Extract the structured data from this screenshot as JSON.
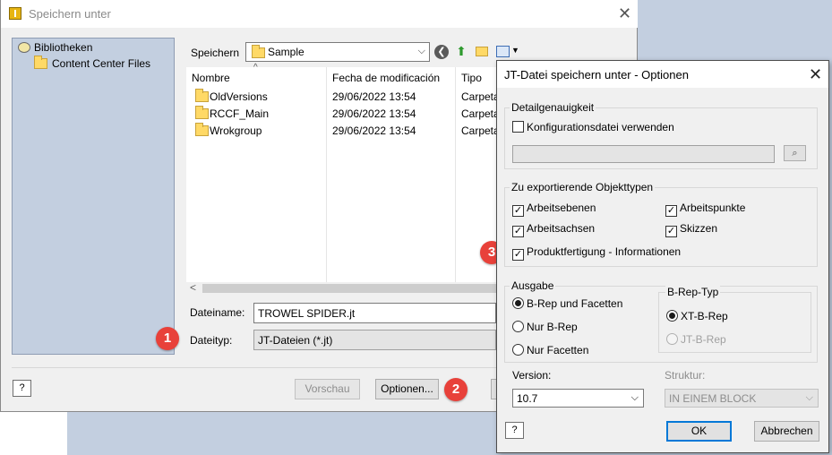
{
  "main_dialog": {
    "title": "Speichern unter",
    "close_glyph": "✕",
    "library": {
      "root": "Bibliotheken",
      "child": "Content Center Files"
    },
    "save_in_label": "Speichern",
    "save_in_value": "Sample",
    "file_list": {
      "columns": [
        "Nombre",
        "Fecha de modificación",
        "Tipo"
      ],
      "rows": [
        {
          "name": "OldVersions",
          "date": "29/06/2022 13:54",
          "type": "Carpeta"
        },
        {
          "name": "RCCF_Main",
          "date": "29/06/2022 13:54",
          "type": "Carpeta"
        },
        {
          "name": "Wrokgroup",
          "date": "29/06/2022 13:54",
          "type": "Carpeta"
        }
      ]
    },
    "filename_label": "Dateiname:",
    "filename_value": "TROWEL SPIDER.jt",
    "filetype_label": "Dateityp:",
    "filetype_value": "JT-Dateien (*.jt)",
    "preview_button": "Vorschau",
    "options_button": "Optionen...",
    "help_glyph": "?"
  },
  "options_dialog": {
    "title": "JT-Datei speichern unter - Optionen",
    "close_glyph": "✕",
    "detail_group": "Detailgenauigkeit",
    "config_checkbox": {
      "label": "Konfigurationsdatei verwenden",
      "checked": false
    },
    "config_path": "",
    "object_types_group": "Zu exportierende Objekttypen",
    "object_types": [
      {
        "label": "Arbeitsebenen",
        "checked": true
      },
      {
        "label": "Arbeitspunkte",
        "checked": true
      },
      {
        "label": "Arbeitsachsen",
        "checked": true
      },
      {
        "label": "Skizzen",
        "checked": true
      },
      {
        "label": "Produktfertigung - Informationen",
        "checked": true
      }
    ],
    "output_group": "Ausgabe",
    "output_options": [
      {
        "label": "B-Rep und Facetten",
        "selected": true
      },
      {
        "label": "Nur B-Rep",
        "selected": false
      },
      {
        "label": "Nur Facetten",
        "selected": false
      }
    ],
    "brep_type_group": "B-Rep-Typ",
    "brep_types": [
      {
        "label": "XT-B-Rep",
        "selected": true
      },
      {
        "label": "JT-B-Rep",
        "selected": false,
        "disabled": true
      }
    ],
    "version_label": "Version:",
    "version_value": "10.7",
    "structure_label": "Struktur:",
    "structure_value": "IN EINEM BLOCK",
    "ok_button": "OK",
    "cancel_button": "Abbrechen",
    "help_glyph": "?"
  },
  "callouts": [
    "1",
    "2",
    "3"
  ],
  "colors": {
    "callout": "#e8413a",
    "default_button_border": "#0078d7",
    "library_panel": "#c3cfe0"
  }
}
